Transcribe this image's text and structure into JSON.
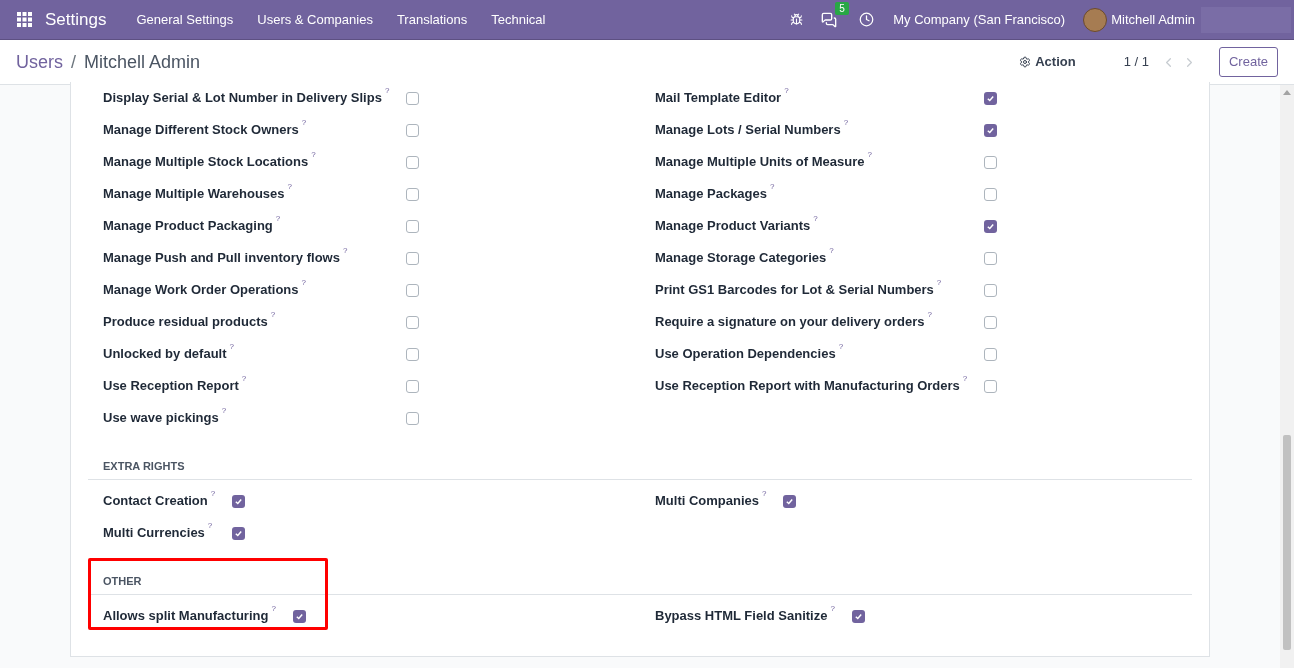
{
  "navbar": {
    "app": "Settings",
    "menus": [
      "General Settings",
      "Users & Companies",
      "Translations",
      "Technical"
    ],
    "chat_count": "5",
    "company": "My Company (San Francisco)",
    "user": "Mitchell Admin"
  },
  "breadcrumb": {
    "parent": "Users",
    "separator": "/",
    "current": "Mitchell Admin"
  },
  "control_panel": {
    "action": "Action",
    "pager": "1 / 1",
    "create": "Create"
  },
  "sections": [
    {
      "highlighted": false,
      "columns": [
        [
          {
            "label": "Display Serial & Lot Number in Delivery Slips",
            "help": "?",
            "checked": false
          },
          {
            "label": "Manage Different Stock Owners",
            "help": "?",
            "checked": false
          },
          {
            "label": "Manage Multiple Stock Locations",
            "help": "?",
            "checked": false
          },
          {
            "label": "Manage Multiple Warehouses",
            "help": "?",
            "checked": false
          },
          {
            "label": "Manage Product Packaging",
            "help": "?",
            "checked": false
          },
          {
            "label": "Manage Push and Pull inventory flows",
            "help": "?",
            "checked": false
          },
          {
            "label": "Manage Work Order Operations",
            "help": "?",
            "checked": false
          },
          {
            "label": "Produce residual products",
            "help": "?",
            "checked": false
          },
          {
            "label": "Unlocked by default",
            "help": "?",
            "checked": false
          },
          {
            "label": "Use Reception Report",
            "help": "?",
            "checked": false
          },
          {
            "label": "Use wave pickings",
            "help": "?",
            "checked": false
          }
        ],
        [
          {
            "label": "Mail Template Editor",
            "help": "?",
            "checked": true
          },
          {
            "label": "Manage Lots / Serial Numbers",
            "help": "?",
            "checked": true
          },
          {
            "label": "Manage Multiple Units of Measure",
            "help": "?",
            "checked": false
          },
          {
            "label": "Manage Packages",
            "help": "?",
            "checked": false
          },
          {
            "label": "Manage Product Variants",
            "help": "?",
            "checked": true
          },
          {
            "label": "Manage Storage Categories",
            "help": "?",
            "checked": false
          },
          {
            "label": "Print GS1 Barcodes for Lot & Serial Numbers",
            "help": "?",
            "checked": false
          },
          {
            "label": "Require a signature on your delivery orders",
            "help": "?",
            "checked": false
          },
          {
            "label": "Use Operation Dependencies",
            "help": "?",
            "checked": false
          },
          {
            "label": "Use Reception Report with Manufacturing Orders",
            "help": "?",
            "checked": false
          }
        ]
      ]
    },
    {
      "title": "EXTRA RIGHTS",
      "highlighted": false,
      "columns": [
        [
          {
            "label": "Contact Creation",
            "help": "?",
            "checked": true
          },
          {
            "label": "Multi Currencies",
            "help": "?",
            "checked": true
          }
        ],
        [
          {
            "label": "Multi Companies",
            "help": "?",
            "checked": true
          }
        ]
      ]
    },
    {
      "title": "OTHER",
      "highlighted": true,
      "columns": [
        [
          {
            "label": "Allows split Manufacturing",
            "help": "?",
            "checked": true
          }
        ],
        [
          {
            "label": "Bypass HTML Field Sanitize",
            "help": "?",
            "checked": true
          }
        ]
      ]
    }
  ]
}
